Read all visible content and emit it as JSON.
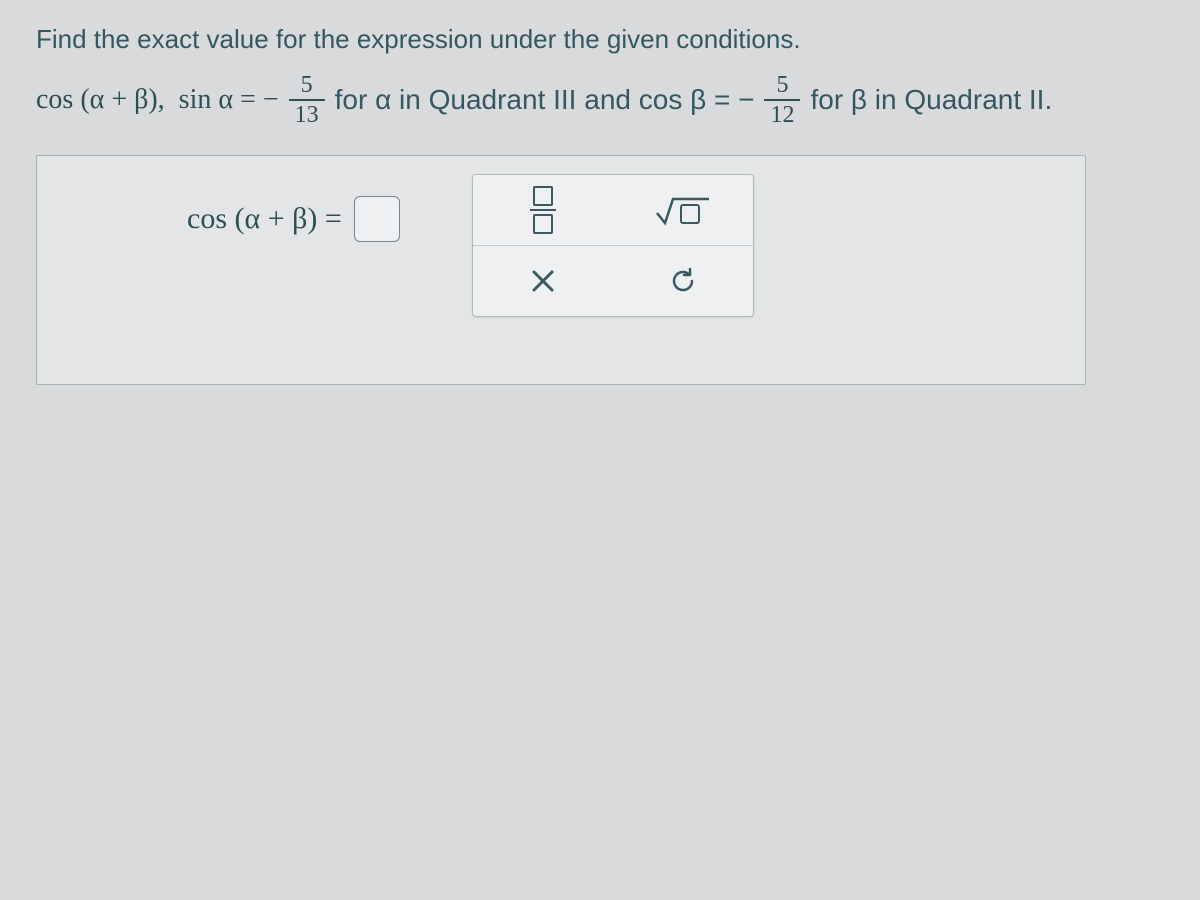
{
  "prompt": {
    "title": "Find the exact value for the expression under the given conditions."
  },
  "expr": {
    "lead": "cos (α + β),  sin α = −",
    "frac1_num": "5",
    "frac1_den": "13",
    "mid1": " for α in Quadrant III and  cos β = −",
    "frac2_num": "5",
    "frac2_den": "12",
    "mid2": " for β in Quadrant II."
  },
  "answer": {
    "label": "cos (α + β) ="
  },
  "palette": {
    "fraction_tool": "fraction",
    "sqrt_tool": "square-root",
    "close_tool": "close",
    "reset_tool": "reset"
  }
}
